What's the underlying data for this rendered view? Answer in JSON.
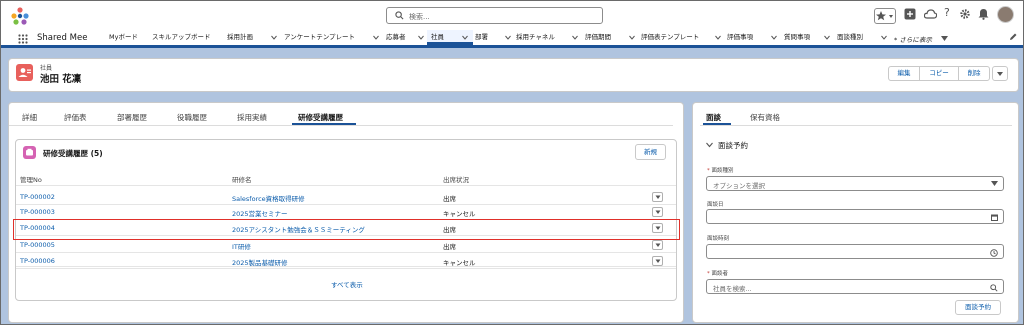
{
  "header": {
    "search_placeholder": "検索...",
    "app_name": "Shared Mee"
  },
  "nav": {
    "tabs": [
      {
        "label": "Myボード",
        "chevron": false
      },
      {
        "label": "スキルアップボード",
        "chevron": false
      },
      {
        "label": "採用計画",
        "chevron": true
      },
      {
        "label": "アンケートテンプレート",
        "chevron": true
      },
      {
        "label": "応募者",
        "chevron": true
      },
      {
        "label": "社員",
        "chevron": true,
        "active": true
      },
      {
        "label": "部署",
        "chevron": true
      },
      {
        "label": "採用チャネル",
        "chevron": true
      },
      {
        "label": "評価期間",
        "chevron": true
      },
      {
        "label": "評価表テンプレート",
        "chevron": true
      },
      {
        "label": "評価事項",
        "chevron": true
      },
      {
        "label": "質問事項",
        "chevron": true
      },
      {
        "label": "面談種別",
        "chevron": true
      }
    ],
    "more_label": "* さらに表示"
  },
  "record": {
    "type_label": "社員",
    "name": "池田 花凜",
    "actions": [
      "編集",
      "コピー",
      "削除"
    ]
  },
  "left_tabs": [
    "詳細",
    "評価表",
    "部署履歴",
    "役職履歴",
    "採用実績",
    "研修受講履歴"
  ],
  "related_list": {
    "title": "研修受講履歴 (5)",
    "new_button": "新規",
    "columns": [
      "管理No",
      "研修名",
      "出席状況"
    ],
    "rows": [
      {
        "no": "TP-000002",
        "name": "Salesforce資格取得研修",
        "status": "出席"
      },
      {
        "no": "TP-000003",
        "name": "2025営業セミナー",
        "status": "キャンセル"
      },
      {
        "no": "TP-000004",
        "name": "2025アシスタント勉強会＆ＳＳミーティング",
        "status": "出席"
      },
      {
        "no": "TP-000005",
        "name": "IT研修",
        "status": "出席"
      },
      {
        "no": "TP-000006",
        "name": "2025製品基礎研修",
        "status": "キャンセル"
      }
    ],
    "view_all": "すべて表示"
  },
  "right_tabs": [
    "面談",
    "保有資格"
  ],
  "meeting": {
    "section_title": "面談予約",
    "type_label": "面談種別",
    "type_placeholder": "オプションを選択",
    "date_label": "面談日",
    "time_label": "面談時刻",
    "interviewer_label": "面談者",
    "interviewer_placeholder": "社員を検索...",
    "submit": "面談予約"
  },
  "colors": {
    "brand": "#1b5297",
    "link": "#0b5cab",
    "record_icon": "#e8605c",
    "list_icon": "#d563b3",
    "highlight": "#e0302a"
  }
}
